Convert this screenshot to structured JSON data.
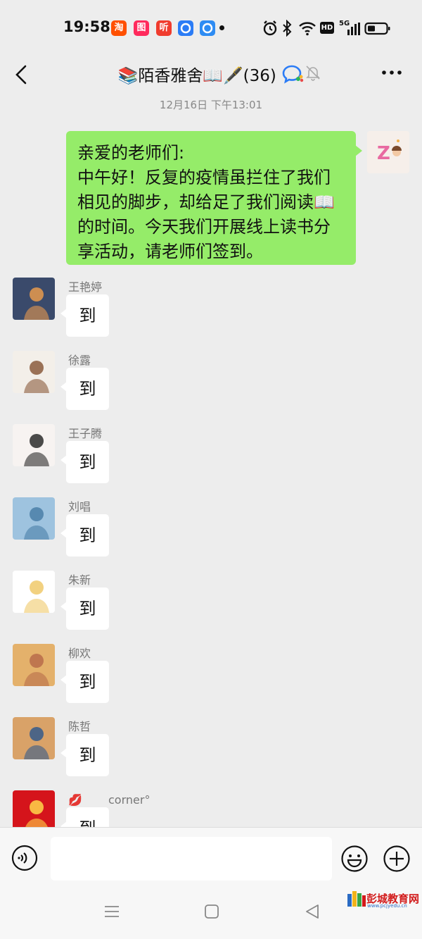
{
  "status_bar": {
    "time": "19:58",
    "apps": [
      {
        "glyph": "淘",
        "color": "#ff5000"
      },
      {
        "glyph": "图",
        "color": "#ff2a5c"
      },
      {
        "glyph": "听",
        "color": "#f03c2e"
      },
      {
        "glyph": "",
        "color": "#2b7cf6"
      },
      {
        "glyph": "",
        "color": "#2e8cf3"
      }
    ],
    "network": "5G",
    "hd": "HD"
  },
  "header": {
    "title": "📚陌香雅舍📖🖋️(36)",
    "back_icon": "chevron-left-icon",
    "more_icon": "more-dots-icon"
  },
  "chat": {
    "timestamp": "12月16日 下午13:01",
    "my_message": "亲爱的老师们:\n中午好！反复的疫情虽拦住了我们相见的脚步，却给足了我们阅读📖的时间。今天我们开展线上读书分享活动，请老师们签到。",
    "messages": [
      {
        "sender": "王艳婷",
        "text": "到",
        "avatar_colors": [
          "#3a4a6b",
          "#e79a4c"
        ]
      },
      {
        "sender": "徐露",
        "text": "到",
        "avatar_colors": [
          "#f3efe9",
          "#8a5a3c"
        ]
      },
      {
        "sender": "王子腾",
        "text": "到",
        "avatar_colors": [
          "#f7f3f1",
          "#2b2b2b"
        ]
      },
      {
        "sender": "刘唱",
        "text": "到",
        "avatar_colors": [
          "#9ec3df",
          "#4a7fa8"
        ]
      },
      {
        "sender": "朱新",
        "text": "到",
        "avatar_colors": [
          "#ffffff",
          "#f0c96a"
        ]
      },
      {
        "sender": "柳欢",
        "text": "到",
        "avatar_colors": [
          "#e4b16b",
          "#b86c4a"
        ]
      },
      {
        "sender": "陈哲",
        "text": "到",
        "avatar_colors": [
          "#d9a268",
          "#345a8c"
        ]
      },
      {
        "sender": "💋　　 corner°",
        "text": "到",
        "avatar_colors": [
          "#d5141b",
          "#ffd54a"
        ]
      }
    ]
  },
  "input_bar": {
    "voice_icon": "voice-icon",
    "placeholder": "",
    "emoji_icon": "emoji-icon",
    "plus_icon": "plus-icon"
  },
  "watermark": {
    "text": "彭城教育网",
    "url": "www.pcjyedu.cn"
  }
}
